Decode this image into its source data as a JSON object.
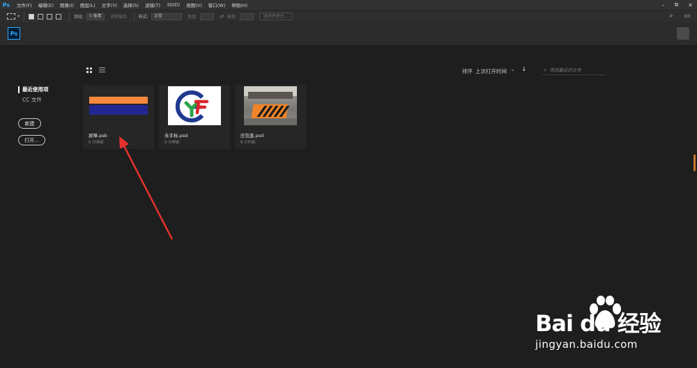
{
  "menubar": {
    "logo": "Ps",
    "items": [
      "文件(F)",
      "编辑(E)",
      "图像(I)",
      "图层(L)",
      "文字(Y)",
      "选择(S)",
      "滤镜(T)",
      "3D(D)",
      "视图(V)",
      "窗口(W)",
      "帮助(H)"
    ],
    "window_controls": [
      "–",
      "⧉",
      "✕"
    ]
  },
  "options_bar": {
    "feather_label": "羽化:",
    "feather_value": "0 像素",
    "antialias_label": "消除锯齿",
    "style_label": "样式:",
    "style_value": "正常",
    "width_label": "宽度:",
    "height_label": "高度:",
    "select_mask_label": "选择并遮住..."
  },
  "start": {
    "logo": "Ps"
  },
  "sidebar": {
    "recent_label": "最近使用项",
    "cc_files_label": "CC 文件",
    "new_label": "新建",
    "open_label": "打开..."
  },
  "toolbar": {
    "sort_label": "排序",
    "sort_value": "上次打开时间",
    "search_placeholder": "筛选最近的文件"
  },
  "recent_files": [
    {
      "name": "屏障.psb",
      "time": "6 分钟前",
      "thumb": "barrier"
    },
    {
      "name": "永丰标.psd",
      "time": "9 分钟前",
      "thumb": "logo"
    },
    {
      "name": "压包盖.psd",
      "time": "8 小时前",
      "thumb": "photo"
    }
  ],
  "watermark": {
    "brand": "Bai du 经验",
    "url": "jingyan.baidu.com"
  },
  "colors": {
    "accent": "#31a8ff",
    "annotation_arrow": "#e5322d",
    "barrier_orange": "#f6893d",
    "barrier_blue": "#232791"
  }
}
